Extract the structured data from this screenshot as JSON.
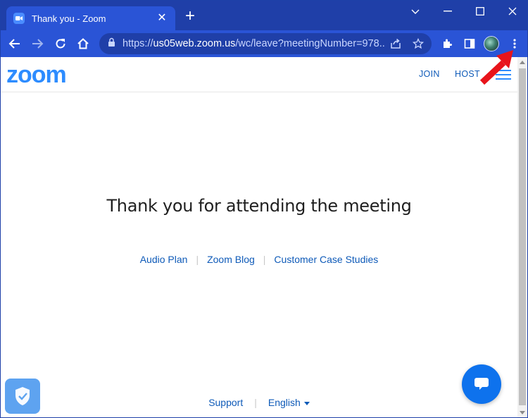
{
  "browser": {
    "tab_title": "Thank you - Zoom",
    "url_host": "us05web.zoom.us",
    "url_prefix": "https://",
    "url_rest": "/wc/leave?meetingNumber=978..."
  },
  "site": {
    "logo": "zoom",
    "nav_join": "JOIN",
    "nav_host": "HOST",
    "headline": "Thank you for attending the meeting",
    "links": [
      "Audio Plan",
      "Zoom Blog",
      "Customer Case Studies"
    ],
    "footer_support": "Support",
    "footer_language": "English"
  },
  "colors": {
    "chrome_dark": "#1f3fa8",
    "chrome_tab": "#2a54d6",
    "zoom_blue": "#2d8cff",
    "link_blue": "#0e5ab8",
    "annotation_red": "#e8141b"
  },
  "icons": {
    "tab_favicon": "zoom-camera-icon",
    "chat": "chat-bubble-icon",
    "shield": "shield-check-icon"
  }
}
